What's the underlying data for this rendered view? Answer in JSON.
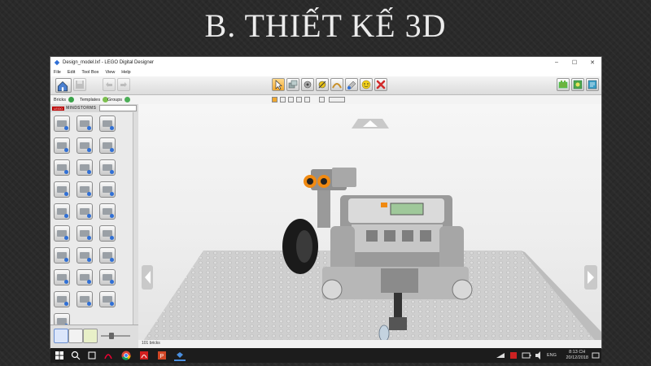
{
  "slide": {
    "title": "B. THIẾT KẾ 3D"
  },
  "window": {
    "title": "Design_model.lxf - LEGO Digital Designer",
    "controls": {
      "minimize": "–",
      "maximize": "☐",
      "close": "✕"
    }
  },
  "menu": [
    "File",
    "Edit",
    "Tool Box",
    "View",
    "Help"
  ],
  "toolbar": {
    "left_icons": [
      "home-icon",
      "save-icon",
      "undo-icon",
      "redo-icon"
    ],
    "center_tools": [
      "select-icon",
      "clone-icon",
      "hinge-icon",
      "hinge-align-icon",
      "flex-icon",
      "paint-icon",
      "hide-icon",
      "delete-icon"
    ],
    "right_icons": [
      "build-mode-icon",
      "view-mode-icon",
      "instructions-icon"
    ]
  },
  "tabs": [
    {
      "label": "Bricks",
      "color": "#3aa34a"
    },
    {
      "label": "Templates",
      "color": "#7dc04f"
    },
    {
      "label": "Groups",
      "color": "#4cae57"
    }
  ],
  "palette": {
    "logo": "LEGO",
    "brand": "MINDSTORMS"
  },
  "statusbar": {
    "text": "101 bricks"
  },
  "taskbar": {
    "language": "ENG",
    "time": "8:13 CH",
    "date": "20/12/2018"
  },
  "colors": {
    "accent": "#2f6fd6",
    "delete": "#d22b2b",
    "robot_gray": "#8c8c8c",
    "robot_orange": "#f08a12"
  }
}
